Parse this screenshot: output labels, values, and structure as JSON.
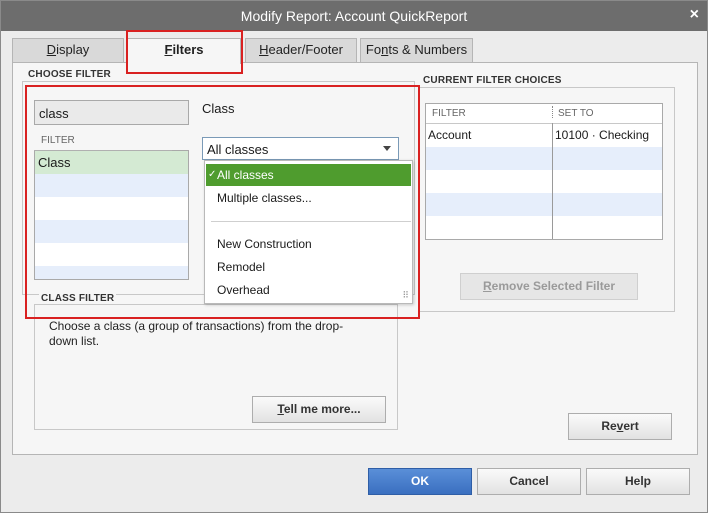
{
  "window": {
    "title": "Modify Report: Account QuickReport",
    "close_symbol": "×"
  },
  "tabs": [
    {
      "label": "Display",
      "mnemonic": "D",
      "rest": "isplay"
    },
    {
      "label": "Filters",
      "mnemonic": "F",
      "rest": "ilters"
    },
    {
      "label": "Header/Footer",
      "mnemonic": "H",
      "rest": "eader/Footer"
    },
    {
      "label": "Fonts & Numbers",
      "pre": "Fo",
      "mnemonic": "n",
      "rest": "ts & Numbers"
    }
  ],
  "choose_filter": {
    "section_label": "CHOOSE FILTER",
    "search_value": "class",
    "list_header": "FILTER",
    "items": [
      "Class",
      "",
      "",
      "",
      "",
      ""
    ]
  },
  "class_panel": {
    "label": "Class",
    "selected_value": "All classes",
    "dropdown_options": [
      "All classes",
      "Multiple classes...",
      "New Construction",
      "Remodel",
      "Overhead"
    ],
    "check_symbol": "✓",
    "grip_symbol": "⠿"
  },
  "class_filter": {
    "section_label": "CLASS FILTER",
    "description": "Choose a class (a group of transactions) from the drop-down list.",
    "tell_me_more": {
      "mnemonic": "T",
      "rest": "ell me more..."
    }
  },
  "current_filters": {
    "section_label": "CURRENT FILTER CHOICES",
    "header_filter": "FILTER",
    "header_set_to": "SET TO",
    "rows": [
      {
        "filter": "Account",
        "set_to": "10100 · Checking"
      },
      {
        "filter": "",
        "set_to": ""
      },
      {
        "filter": "",
        "set_to": ""
      },
      {
        "filter": "",
        "set_to": ""
      },
      {
        "filter": "",
        "set_to": ""
      }
    ],
    "remove_button": {
      "mnemonic": "R",
      "rest": "emove Selected Filter"
    }
  },
  "revert_button": {
    "mnemonic": "v",
    "pre": "Re",
    "rest": "ert"
  },
  "footer": {
    "ok": "OK",
    "cancel": "Cancel",
    "help": "Help"
  },
  "colors": {
    "selected_green": "#4f9c2e",
    "annotation_red": "#d92121",
    "primary_blue": "#3a6fc0"
  }
}
